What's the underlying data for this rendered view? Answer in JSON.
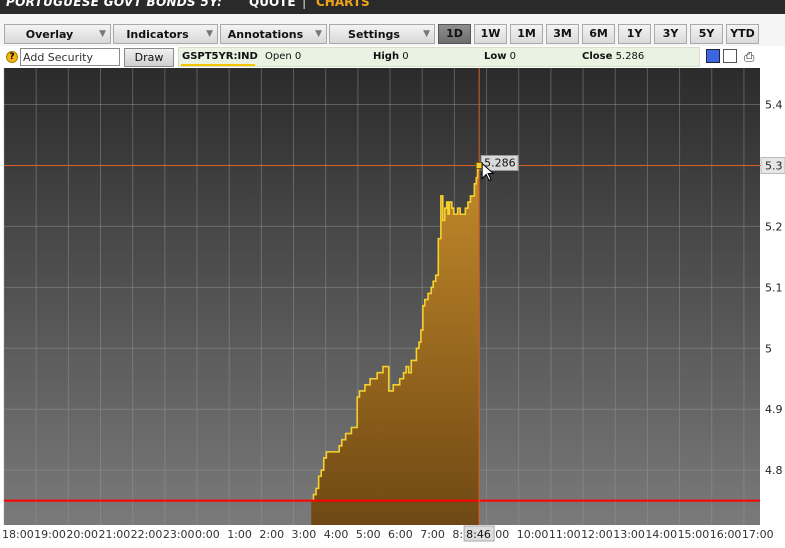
{
  "titlebar": {
    "title": "PORTUGUESE GOVT BONDS 5Y:",
    "quote": "QUOTE",
    "separator": "|",
    "charts": "CHARTS"
  },
  "toolbar": {
    "dropdowns": [
      {
        "label": "Overlay",
        "icon": "chevron-down-icon"
      },
      {
        "label": "Indicators",
        "icon": "chevron-down-icon"
      },
      {
        "label": "Annotations",
        "icon": "chevron-down-icon"
      },
      {
        "label": "Settings",
        "icon": "chevron-down-icon"
      }
    ],
    "ranges": [
      "1D",
      "1W",
      "1M",
      "3M",
      "6M",
      "1Y",
      "3Y",
      "5Y",
      "YTD"
    ],
    "active_range": "1D"
  },
  "security_row": {
    "help_icon": "question-icon",
    "help_glyph": "?",
    "add_security_value": "Add Security",
    "draw_label": "Draw",
    "ticker": "GSPT5YR:IND",
    "open_label": "Open",
    "open_value": "0",
    "high_label": "High",
    "high_value": "0",
    "low_label": "Low",
    "low_value": "0",
    "close_label": "Close",
    "close_value": "5.286",
    "print_icon": "printer-icon"
  },
  "colors": {
    "line": "#f5d130",
    "fill_top": "#c48a2a",
    "fill_bottom": "#6e4814",
    "crosshair": "#d9602a",
    "reference_line": "#ff0000",
    "background_top": "#2b2b2b",
    "background_bottom": "#7a7a7a"
  },
  "chart_data": {
    "type": "area",
    "ylim": [
      4.71,
      5.46
    ],
    "yticks": [
      "5.4",
      "5.3",
      "5.2",
      "5.1",
      "5",
      "4.9",
      "4.8"
    ],
    "ytick_values": [
      5.4,
      5.3,
      5.2,
      5.1,
      5.0,
      4.9,
      4.8
    ],
    "xlim": [
      -6.0,
      17.5
    ],
    "xticks": [
      "18:00",
      "19:00",
      "20:00",
      "21:00",
      "22:00",
      "23:00",
      "0:00",
      "1:00",
      "2:00",
      "3:00",
      "4:00",
      "5:00",
      "6:00",
      "7:00",
      "8:00",
      "9:00",
      "10:00",
      "11:00",
      "12:00",
      "13:00",
      "14:00",
      "15:00",
      "16:00",
      "17:00"
    ],
    "xtick_values": [
      -6,
      -5,
      -4,
      -3,
      -2,
      -1,
      0,
      1,
      2,
      3,
      4,
      5,
      6,
      7,
      8,
      9,
      10,
      11,
      12,
      13,
      14,
      15,
      16,
      17
    ],
    "crosshair": {
      "time": 8.77,
      "value": 5.3,
      "time_label": "8:46",
      "value_label": "5.286",
      "y_axis_label": "5.3"
    },
    "reference_value": 4.75,
    "series": [
      {
        "x": [
          3.55,
          3.62,
          3.7,
          3.78,
          3.86,
          3.94,
          4.02,
          4.1,
          4.2,
          4.3,
          4.42,
          4.5,
          4.55,
          4.62,
          4.7,
          4.8,
          4.9,
          4.98,
          5.05,
          5.15,
          5.22,
          5.3,
          5.38,
          5.45,
          5.52,
          5.6,
          5.68,
          5.78,
          5.88,
          5.96,
          6.03,
          6.1,
          6.2,
          6.3,
          6.42,
          6.5,
          6.58,
          6.66,
          6.74,
          6.82,
          6.9,
          6.96,
          7.02,
          7.08,
          7.12,
          7.18,
          7.22,
          7.28,
          7.34,
          7.42,
          7.5,
          7.58,
          7.64,
          7.7,
          7.76,
          7.8,
          7.84,
          7.88,
          7.92,
          7.98,
          8.04,
          8.1,
          8.18,
          8.26,
          8.34,
          8.42,
          8.5,
          8.55,
          8.62,
          8.68,
          8.72,
          8.76
        ],
        "y": [
          4.75,
          4.76,
          4.77,
          4.79,
          4.8,
          4.82,
          4.83,
          4.83,
          4.83,
          4.83,
          4.84,
          4.85,
          4.85,
          4.86,
          4.86,
          4.87,
          4.87,
          4.92,
          4.93,
          4.93,
          4.94,
          4.94,
          4.95,
          4.95,
          4.95,
          4.96,
          4.96,
          4.97,
          4.97,
          4.93,
          4.93,
          4.94,
          4.94,
          4.95,
          4.96,
          4.97,
          4.96,
          4.98,
          4.98,
          5.0,
          5.01,
          5.03,
          5.07,
          5.08,
          5.08,
          5.09,
          5.09,
          5.1,
          5.11,
          5.12,
          5.18,
          5.25,
          5.21,
          5.23,
          5.24,
          5.22,
          5.24,
          5.24,
          5.23,
          5.22,
          5.22,
          5.23,
          5.22,
          5.22,
          5.23,
          5.24,
          5.25,
          5.25,
          5.27,
          5.28,
          5.3,
          5.29
        ]
      }
    ]
  }
}
